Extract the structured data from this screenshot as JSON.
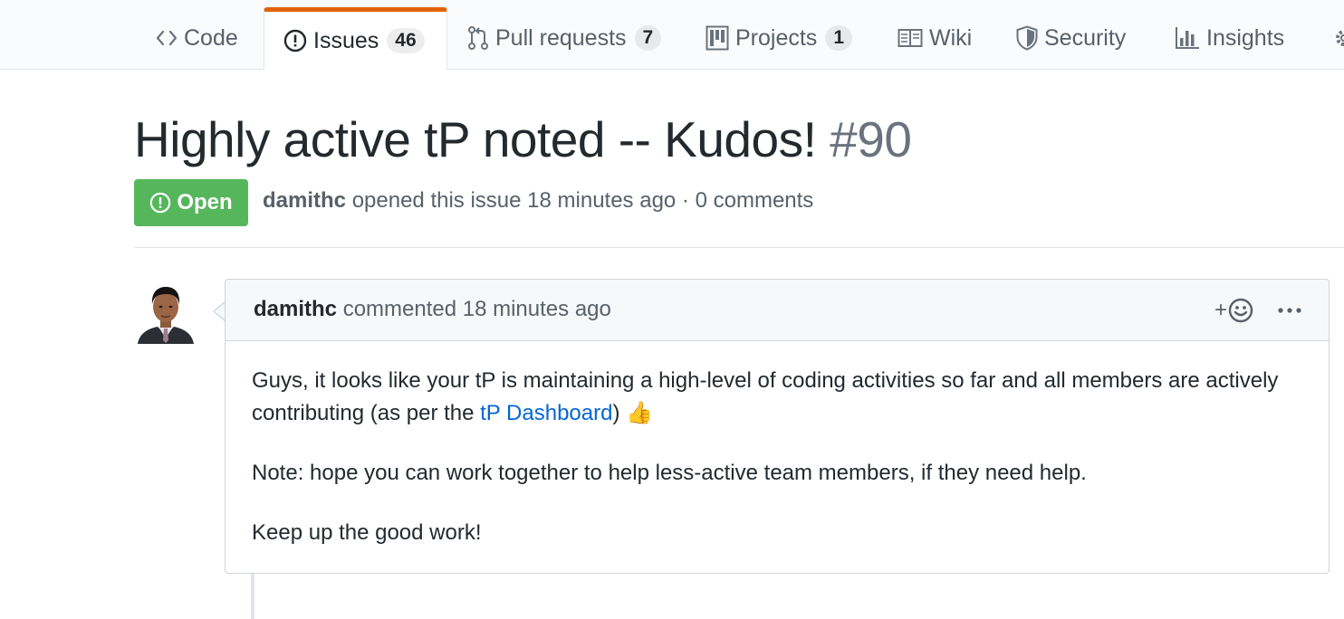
{
  "tabs": {
    "code": {
      "label": "Code",
      "icon": "code-icon"
    },
    "issues": {
      "label": "Issues",
      "count": "46",
      "icon": "issue-opened-icon"
    },
    "pulls": {
      "label": "Pull requests",
      "count": "7",
      "icon": "git-pull-request-icon"
    },
    "projects": {
      "label": "Projects",
      "count": "1",
      "icon": "project-icon"
    },
    "wiki": {
      "label": "Wiki",
      "icon": "book-icon"
    },
    "security": {
      "label": "Security",
      "icon": "shield-icon"
    },
    "insights": {
      "label": "Insights",
      "icon": "graph-icon"
    }
  },
  "issue": {
    "title": "Highly active tP noted -- Kudos!",
    "number": "#90",
    "state": "Open",
    "author": "damithc",
    "meta_text": "opened this issue 18 minutes ago · 0 comments"
  },
  "comment": {
    "author": "damithc",
    "header_text": "commented 18 minutes ago",
    "reaction_label": "+",
    "body": {
      "p1_before": "Guys, it looks like your tP is maintaining a high-level of coding activities so far and all members are actively contributing (as per the ",
      "p1_link": "tP Dashboard",
      "p1_after": ") ",
      "p1_emoji": "👍",
      "p2": "Note: hope you can work together to help less-active team members, if they need help.",
      "p3": "Keep up the good work!"
    }
  },
  "colors": {
    "accent_orange": "#e36209",
    "open_green": "#56b65c",
    "link_blue": "#0366d6"
  }
}
